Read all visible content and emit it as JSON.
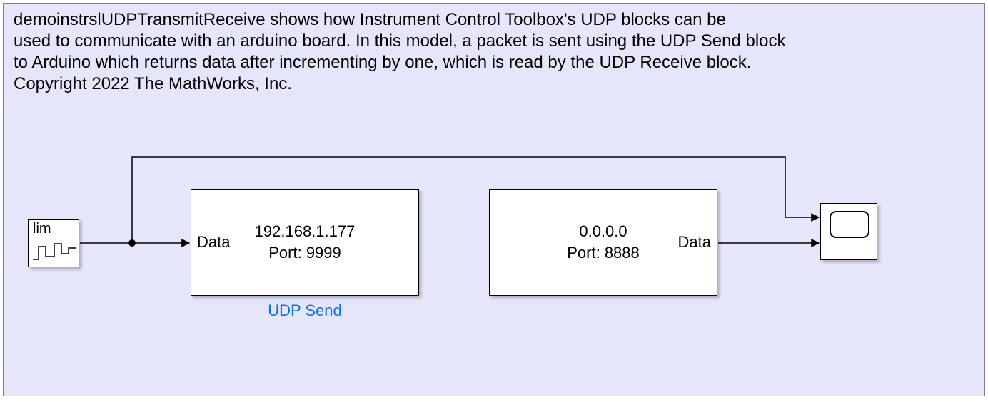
{
  "description": {
    "line1": "demoinstrslUDPTransmitReceive shows how Instrument Control Toolbox's UDP blocks can be",
    "line2": "used to communicate with an arduino board.  In this model, a packet is sent using the UDP Send block",
    "line3": "to Arduino which returns data after incrementing by one, which is read by the UDP Receive block.",
    "line4": "Copyright 2022 The MathWorks, Inc."
  },
  "source_block": {
    "lim_label": "lim"
  },
  "udp_send": {
    "port_in_label": "Data",
    "ip": "192.168.1.177",
    "port_text": "Port: 9999",
    "block_name": "UDP Send"
  },
  "udp_receive": {
    "ip": "0.0.0.0",
    "port_text": "Port: 8888",
    "port_out_label": "Data"
  },
  "colors": {
    "canvas_bg": "#e6e6fa",
    "link_blue": "#0b6cff"
  }
}
